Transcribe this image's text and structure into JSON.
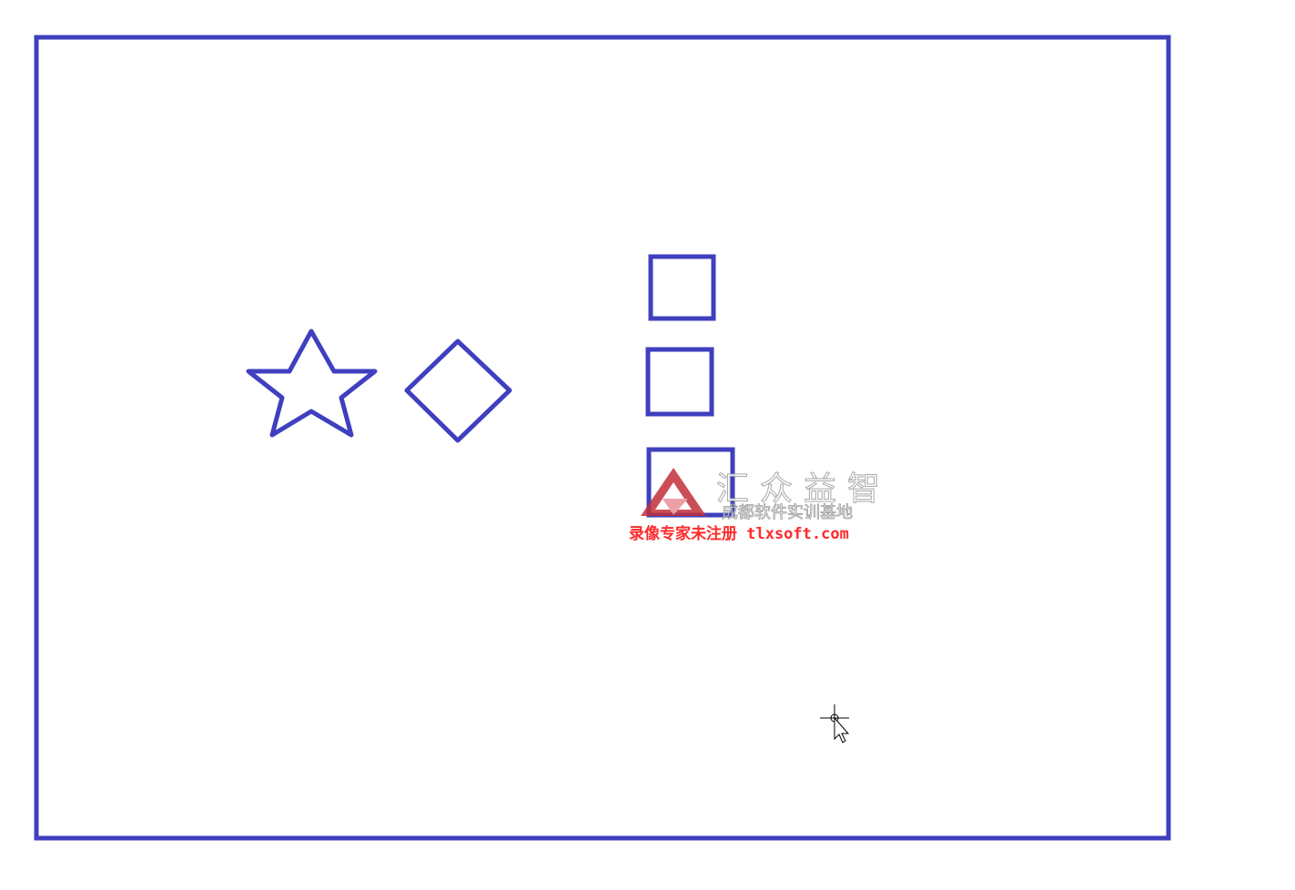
{
  "canvas": {
    "stroke_color": "#3f3fbf",
    "background_color": "#ffffff",
    "shapes": [
      "rectangle-frame",
      "star",
      "diamond",
      "square",
      "square",
      "rectangle"
    ],
    "cursor": "crosshair-arrow-cursor-icon"
  },
  "watermark": {
    "brand_text": "汇众益智",
    "sub_text": "成都软件实训基地",
    "logo_color": "#c2303a",
    "recorder_text": "录像专家未注册 tlxsoft.com",
    "recorder_color": "#ff2a2a"
  }
}
